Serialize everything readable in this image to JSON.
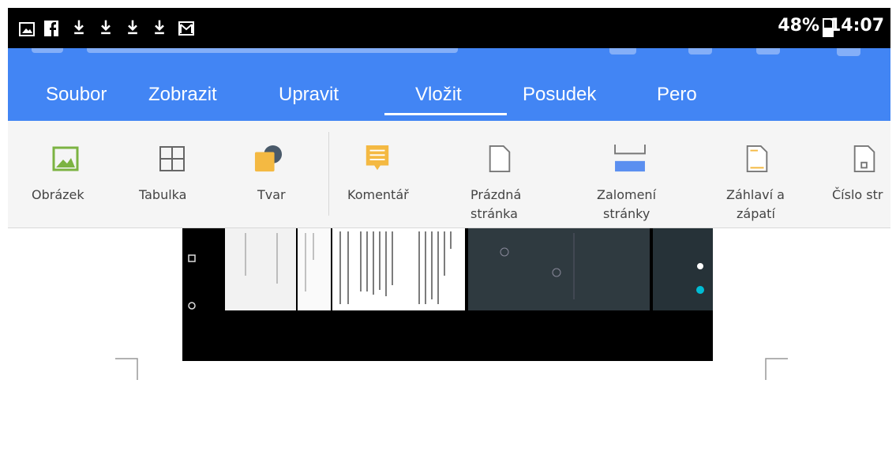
{
  "status_bar": {
    "icons": [
      "image-icon",
      "facebook-icon",
      "download-icon",
      "download-icon",
      "download-icon",
      "download-icon",
      "gmail-icon"
    ],
    "battery": "48%",
    "time": "14:07"
  },
  "menu_tabs": [
    {
      "label": "Soubor",
      "active": false
    },
    {
      "label": "Zobrazit",
      "active": false
    },
    {
      "label": "Upravit",
      "active": false
    },
    {
      "label": "Vložit",
      "active": true
    },
    {
      "label": "Posudek",
      "active": false
    },
    {
      "label": "Pero",
      "active": false
    }
  ],
  "toolbar": {
    "items": [
      {
        "icon": "image-icon",
        "label": "Obrázek"
      },
      {
        "icon": "table-icon",
        "label": "Tabulka"
      },
      {
        "icon": "shape-icon",
        "label": "Tvar"
      },
      {
        "icon": "comment-icon",
        "label": "Komentář"
      },
      {
        "icon": "blank-page-icon",
        "label_line1": "Prázdná",
        "label_line2": "stránka"
      },
      {
        "icon": "page-break-icon",
        "label_line1": "Zalomení",
        "label_line2": "stránky"
      },
      {
        "icon": "header-footer-icon",
        "label_line1": "Záhlaví a",
        "label_line2": "zápatí"
      },
      {
        "icon": "page-number-icon",
        "label": "Číslo str"
      }
    ]
  },
  "colors": {
    "app_bar": "#4285f4",
    "status_bar": "#000000",
    "toolbar_bg": "#f5f5f5",
    "image_icon": "#7cb342",
    "shape_icon": "#f4b942",
    "comment_icon": "#f4b942",
    "page_break": "#4285f4"
  }
}
